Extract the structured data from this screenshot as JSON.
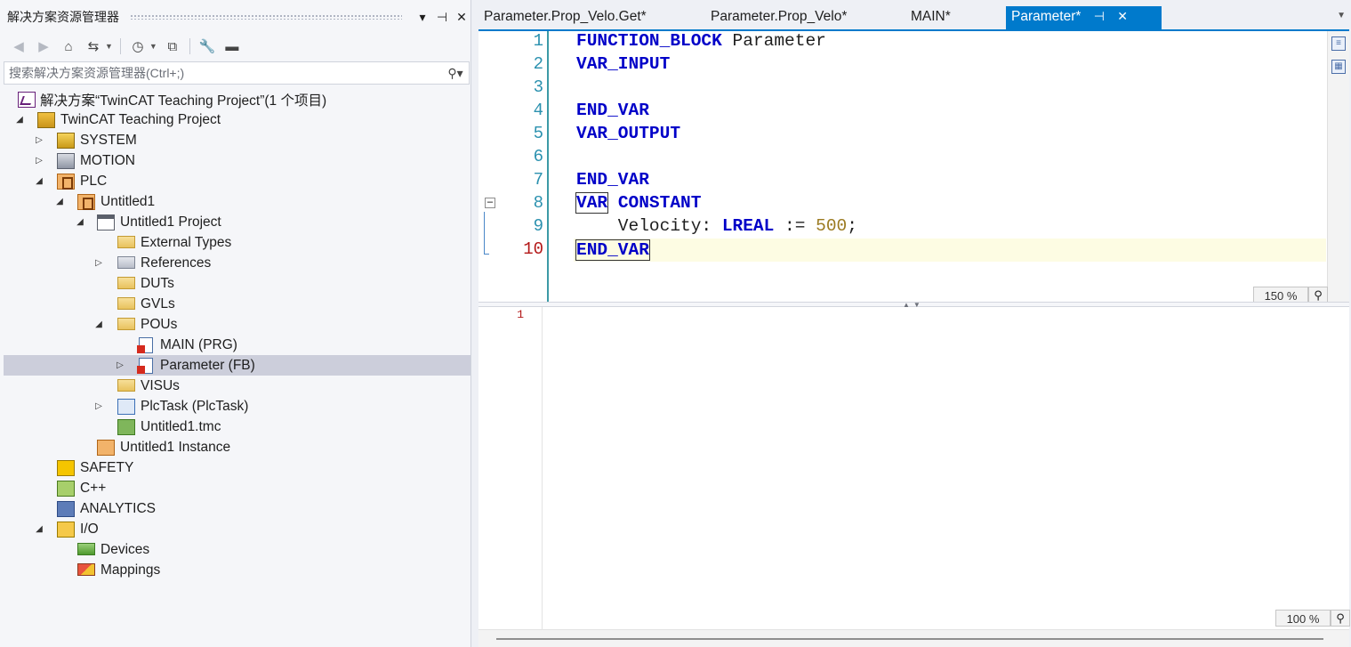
{
  "solution_explorer": {
    "title": "解决方案资源管理器",
    "title_buttons": [
      "▾",
      "⊣",
      "✕"
    ],
    "search_placeholder": "搜索解决方案资源管理器(Ctrl+;)",
    "tree": [
      {
        "label": "解决方案“TwinCAT Teaching Project”(1 个项目)",
        "icon": "solution-icon"
      },
      {
        "label": "TwinCAT Teaching Project",
        "icon": "twincat-project-icon"
      },
      {
        "label": "SYSTEM",
        "icon": "system-icon"
      },
      {
        "label": "MOTION",
        "icon": "motion-icon"
      },
      {
        "label": "PLC",
        "icon": "plc-icon"
      },
      {
        "label": "Untitled1",
        "icon": "plc-project-icon"
      },
      {
        "label": "Untitled1 Project",
        "icon": "plc-subproject-icon"
      },
      {
        "label": "External Types",
        "icon": "folder-icon"
      },
      {
        "label": "References",
        "icon": "references-icon"
      },
      {
        "label": "DUTs",
        "icon": "folder-icon"
      },
      {
        "label": "GVLs",
        "icon": "folder-icon"
      },
      {
        "label": "POUs",
        "icon": "folder-open-icon"
      },
      {
        "label": "MAIN (PRG)",
        "icon": "pou-icon"
      },
      {
        "label": "Parameter (FB)",
        "icon": "pou-icon"
      },
      {
        "label": "VISUs",
        "icon": "folder-icon"
      },
      {
        "label": "PlcTask (PlcTask)",
        "icon": "task-icon"
      },
      {
        "label": "Untitled1.tmc",
        "icon": "tmc-icon"
      },
      {
        "label": "Untitled1 Instance",
        "icon": "instance-icon"
      },
      {
        "label": "SAFETY",
        "icon": "safety-icon"
      },
      {
        "label": "C++",
        "icon": "cpp-icon"
      },
      {
        "label": "ANALYTICS",
        "icon": "analytics-icon"
      },
      {
        "label": "I/O",
        "icon": "io-icon"
      },
      {
        "label": "Devices",
        "icon": "devices-icon"
      },
      {
        "label": "Mappings",
        "icon": "mappings-icon"
      }
    ]
  },
  "tabs": [
    {
      "label": "Parameter.Prop_Velo.Get*"
    },
    {
      "label": "Parameter.Prop_Velo*"
    },
    {
      "label": "MAIN*"
    },
    {
      "label": "Parameter*",
      "pin": "⊣",
      "close": "✕"
    }
  ],
  "declaration": {
    "line_numbers": [
      "1",
      "2",
      "3",
      "4",
      "5",
      "6",
      "7",
      "8",
      "9",
      "10"
    ],
    "zoom": "150 %"
  },
  "implementation": {
    "line_numbers": [
      "1"
    ],
    "zoom": "100 %"
  },
  "colors": {
    "accent": "#007acc",
    "keyword": "#0000c8",
    "number": "#9b7a20",
    "line_number": "#2b91af",
    "current_line_number": "#b31717"
  }
}
